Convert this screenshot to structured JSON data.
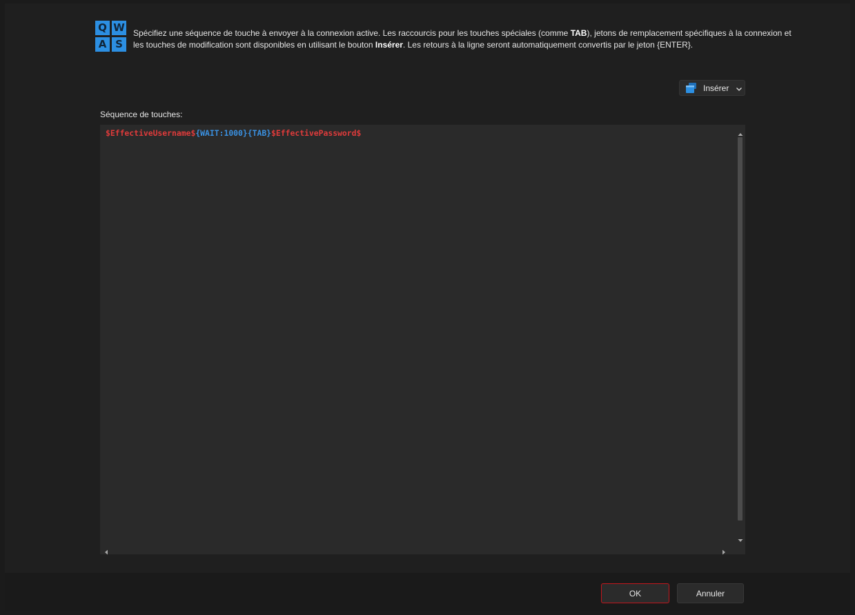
{
  "header": {
    "icon_keys": [
      "Q",
      "W",
      "A",
      "S"
    ],
    "description": {
      "part1": "Spécifiez une séquence de touche à envoyer à la connexion active. Les raccourcis pour les touches spéciales (comme ",
      "bold1": "TAB",
      "part2": "), jetons de remplacement spécifiques à la connexion et les touches de modification sont disponibles en utilisant le bouton ",
      "bold2": "Insérer",
      "part3": ". Les retours à la ligne seront automatiquement convertis par le jeton {ENTER}."
    }
  },
  "toolbar": {
    "insert_label": "Insérer",
    "insert_icon": "window-stack-icon"
  },
  "sequence": {
    "label": "Séquence de touches:",
    "tokens": {
      "t1": "$EffectiveUsername$",
      "t2": "{WAIT:1000}",
      "t3": "{TAB}",
      "t4": "$EffectivePassword$"
    }
  },
  "footer": {
    "ok_label": "OK",
    "cancel_label": "Annuler"
  },
  "colors": {
    "accent": "#2c8fe2",
    "variable": "#e03b3b",
    "token": "#3a90e0",
    "ok_border": "#c4161c"
  }
}
